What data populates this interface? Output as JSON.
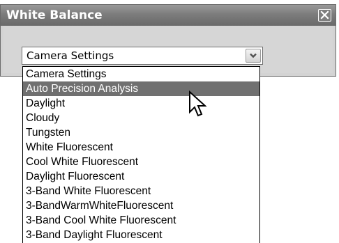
{
  "dialog": {
    "title": "White Balance"
  },
  "combo": {
    "value": "Camera Settings"
  },
  "dropdown": {
    "selected_index": 1,
    "options": [
      "Camera Settings",
      "Auto Precision Analysis",
      "Daylight",
      "Cloudy",
      "Tungsten",
      "White Fluorescent",
      "Cool White Fluorescent",
      "Daylight Fluorescent",
      "3-Band White Fluorescent",
      "3-BandWarmWhiteFluorescent",
      "3-Band Cool White Fluorescent",
      "3-Band Daylight Fluorescent"
    ]
  },
  "icons": {
    "close": "close-icon",
    "dropdown_arrow": "chevron-down-icon",
    "cursor": "mouse-pointer-icon"
  },
  "colors": {
    "titlebar": "#7c7c7c",
    "dialog_bg": "#d6d6d6",
    "selection": "#707070"
  }
}
